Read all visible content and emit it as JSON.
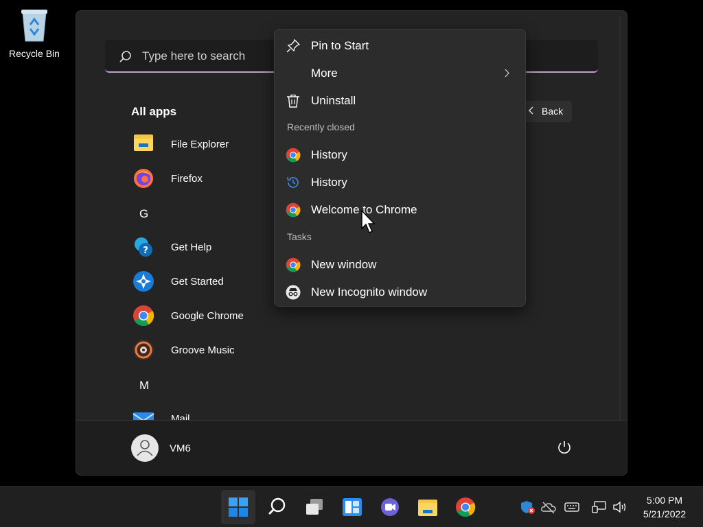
{
  "desktop": {
    "recycle_bin_label": "Recycle Bin"
  },
  "start_menu": {
    "search": {
      "placeholder": "Type here to search"
    },
    "back_label": "Back",
    "all_apps_heading": "All apps",
    "apps": [
      {
        "name": "File Explorer",
        "icon": "folder-icon"
      },
      {
        "name": "Firefox",
        "icon": "firefox-icon"
      },
      {
        "letter": "G"
      },
      {
        "name": "Get Help",
        "icon": "get-help-icon"
      },
      {
        "name": "Get Started",
        "icon": "get-started-icon"
      },
      {
        "name": "Google Chrome",
        "icon": "chrome-icon"
      },
      {
        "name": "Groove Music",
        "icon": "groove-music-icon"
      },
      {
        "letter": "M"
      },
      {
        "name": "Mail",
        "icon": "mail-icon"
      }
    ],
    "user_name": "VM6"
  },
  "context_menu": {
    "pin_to_start": "Pin to Start",
    "more": "More",
    "uninstall": "Uninstall",
    "recently_closed_heading": "Recently closed",
    "recently_closed": [
      {
        "label": "History",
        "icon": "chrome-icon"
      },
      {
        "label": "History",
        "icon": "history-icon"
      },
      {
        "label": "Welcome to Chrome",
        "icon": "chrome-icon"
      }
    ],
    "tasks_heading": "Tasks",
    "tasks": [
      {
        "label": "New window",
        "icon": "chrome-icon"
      },
      {
        "label": "New Incognito window",
        "icon": "incognito-icon"
      }
    ]
  },
  "taskbar": {
    "apps": [
      "start-icon",
      "search-icon",
      "task-view-icon",
      "widgets-icon",
      "teams-chat-icon",
      "file-explorer-icon",
      "chrome-icon"
    ],
    "tray": [
      "security-warning-icon",
      "onedrive-offline-icon",
      "keyboard-icon",
      "network-icon",
      "volume-icon"
    ],
    "time": "5:00 PM",
    "date": "5/21/2022"
  },
  "colors": {
    "accent_underline": "#c79cd6",
    "menu_bg": "#2c2c2c",
    "start_bg": "#242424",
    "taskbar_bg": "#202020"
  }
}
